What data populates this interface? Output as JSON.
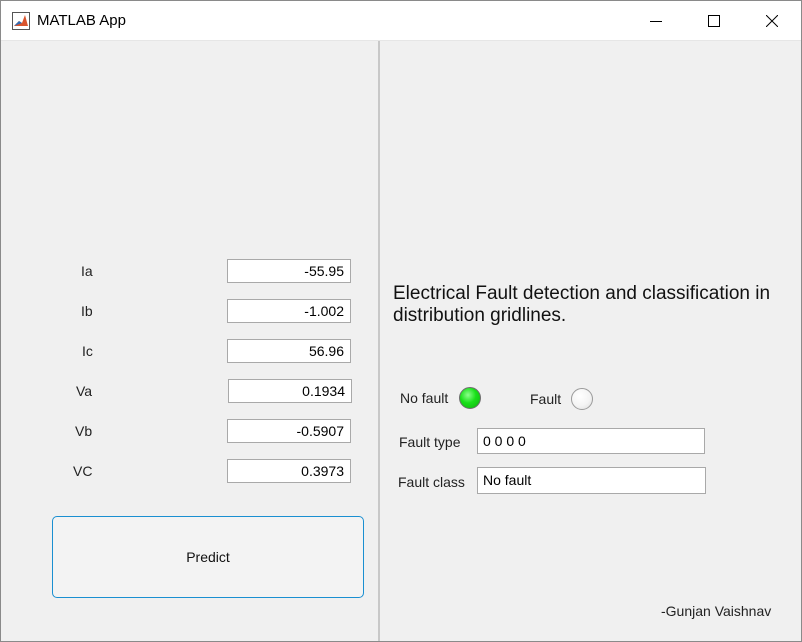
{
  "window": {
    "title": "MATLAB App",
    "controls": {
      "minimize": "minimize",
      "maximize": "maximize",
      "close": "close"
    }
  },
  "inputs": [
    {
      "label": "Ia",
      "value": "-55.95"
    },
    {
      "label": "Ib",
      "value": "-1.002"
    },
    {
      "label": "Ic",
      "value": "56.96"
    },
    {
      "label": "Va",
      "value": "0.1934"
    },
    {
      "label": "Vb",
      "value": "-0.5907"
    },
    {
      "label": "VC",
      "value": "0.3973"
    }
  ],
  "predict_button": {
    "label": "Predict"
  },
  "heading": "Electrical Fault detection and classification in distribution gridlines.",
  "lamps": {
    "no_fault": {
      "label": "No fault",
      "state": "on",
      "color": "#19e019"
    },
    "fault": {
      "label": "Fault",
      "state": "off",
      "color": "#f4f4f4"
    }
  },
  "results": {
    "fault_type": {
      "label": "Fault type",
      "value": "0 0 0 0"
    },
    "fault_class": {
      "label": "Fault class",
      "value": "No fault"
    }
  },
  "author": "-Gunjan Vaishnav",
  "colors": {
    "accent": "#1a8fd1",
    "background": "#f0f0f0"
  }
}
